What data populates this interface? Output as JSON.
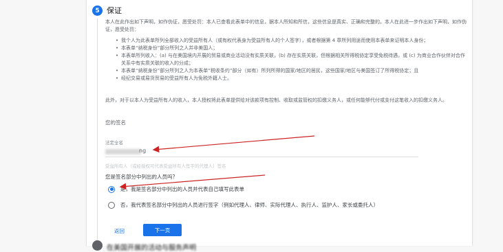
{
  "step": {
    "number": "5",
    "title": "保证",
    "intro": "本人在此作出如下声明，如作伪证，愿受处罚：本人已查看此表单中的信息，据本人所知和所信，这些信息是真实、正确和完整的。本人在此进一步作出如下声明，如作伪证，愿受处罚：",
    "bullets": [
      "我个人为此表单所列全部收入的受益所有人（或有权代表身为受益所有人的个人签字），或者根据第 4 章所列用途而使用本表单来证明本人身份；",
      "本表单“纳税身份”部分所列之人并非美国人；",
      "本表单所列收入：(a) 与在美国境内开展的贸易或商业活动没有实质关联，(b) 存在实质关联，但根据相关所得税协定享受免税待遇，或 (c) 为商业合作伙伴对合作关系中有实质关联的收入的分成；",
      "本表单“纳税身份”部分所列之人为本表单“税收条约”部分（如有）所列所得的国家/地区的居民，这些国家/地区与美国签订了所得税协定；且",
      "经纪交易或易货贸易的受益所有人为免税外籍人士。"
    ],
    "authorization": "此外，对于以本人为受益所有人的收入，本人授权将此表单提供给对该款项有控制、收取或监管权的扣缴义务人，或任何能够代付或支付这笔收入的扣缴义务人。"
  },
  "signature": {
    "section_label": "您的签名",
    "legal_name_label": "法定全名",
    "legal_name_value": "ng",
    "helper": "受益所有人（或经授权可代表受益所有人签字的代理人）签名"
  },
  "question": {
    "text": "您是签名部分中列出的人员吗？",
    "options": [
      {
        "label": "是，我是签名部分中列出的人员并代表自己填写此表单",
        "selected": true
      },
      {
        "label": "否，我代表签名部分中列出的人员进行签字（例如代理人、律师、实际代理人、执行人、监护人、家长或委托人）",
        "selected": false
      }
    ]
  },
  "buttons": {
    "back": "返回",
    "next": "下一页"
  },
  "next_step_title": "在美国开展的活动与服务声明",
  "colors": {
    "accent": "#1a73e8",
    "annotation_arrow": "#cc2222"
  }
}
